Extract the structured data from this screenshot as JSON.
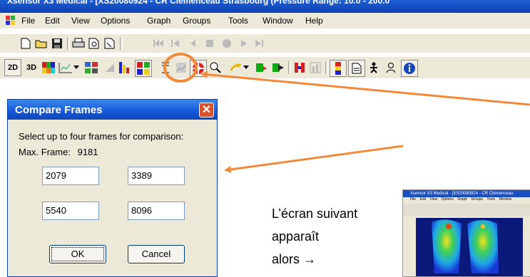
{
  "window": {
    "title": "Xsensor X3 Medical - [XS20080924 - CR Clémenceau Strasbourg (Pressure Range: 10.0 - 200.0"
  },
  "menubar": {
    "items": [
      "File",
      "Edit",
      "View",
      "Options",
      "Graph",
      "Groups",
      "Tools",
      "Window",
      "Help"
    ]
  },
  "toolbar3": {
    "btn_2d": "2D",
    "btn_3d": "3D"
  },
  "dialog": {
    "title": "Compare Frames",
    "close": "✕",
    "instruction": "Select up to four frames for comparison:",
    "max_frame_label": "Max. Frame:",
    "max_frame_value": "9181",
    "frames": [
      "2079",
      "3389",
      "5540",
      "8096"
    ],
    "ok_label": "OK",
    "cancel_label": "Cancel"
  },
  "annotation": {
    "line1": "L’écran suivant",
    "line2": "apparaît",
    "line3": "alors →"
  },
  "thumbnail": {
    "title": "Xsensor X3 Medical - [XS20080924 - CR Clémenceau",
    "menu": [
      "File",
      "Edit",
      "View",
      "Options",
      "Graph",
      "Groups",
      "Tools",
      "Window"
    ]
  },
  "colors": {
    "highlight_circle": "#f08a3a",
    "arrow": "#f08a3a",
    "title_blue": "#1557d6"
  }
}
